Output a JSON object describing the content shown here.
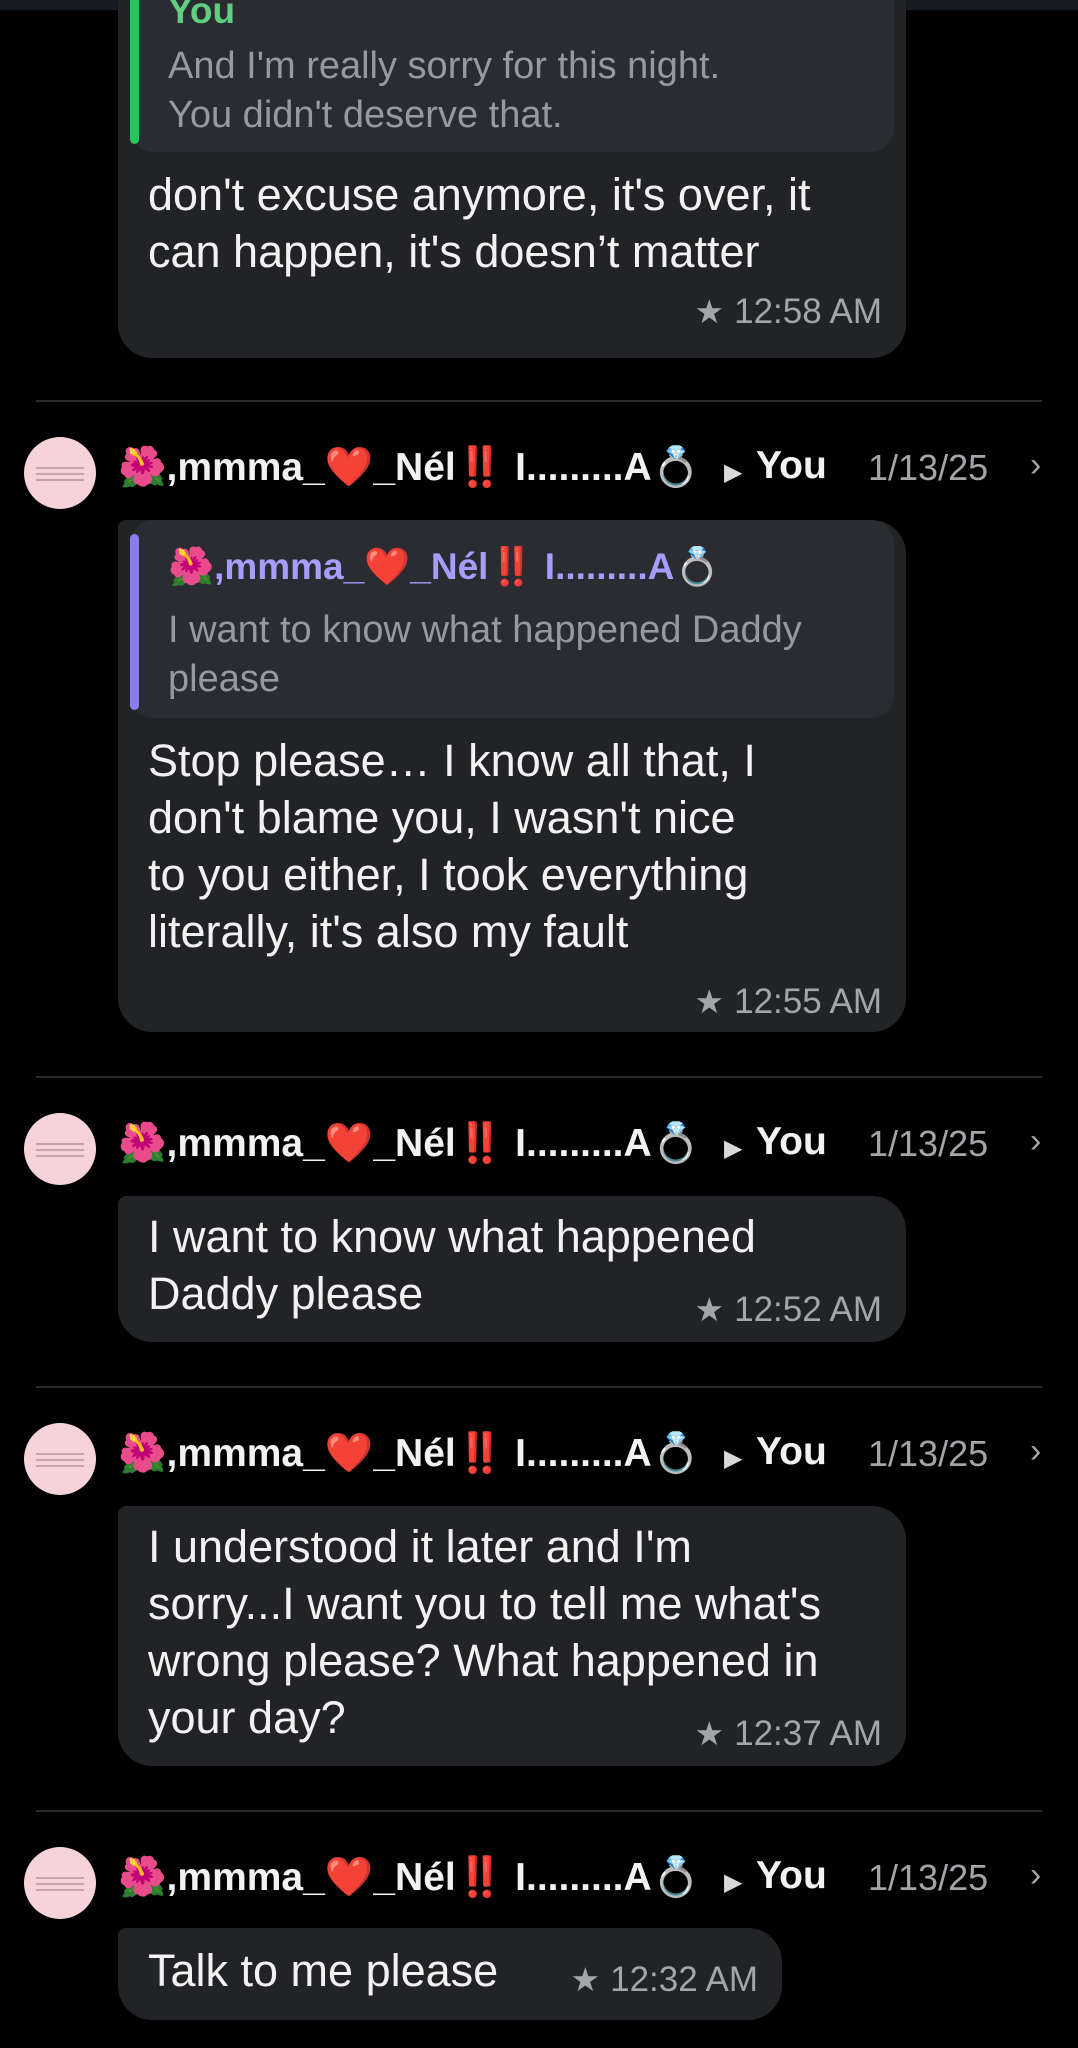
{
  "sender_name": "🌺,mmma_❤️_Nél",
  "sender_marks": "‼️",
  "sender_suffix": " I.........A💍",
  "recipient": "You",
  "star_icon": "star-icon",
  "colors": {
    "background": "#000000",
    "bubble": "#212327",
    "quote_bar_you": "#22c55e",
    "quote_bar_contact": "#8b7cf6"
  },
  "messages": [
    {
      "quote": {
        "author": "You",
        "text_lines": [
          "And I'm really sorry for this night.",
          "You didn't deserve that."
        ]
      },
      "text_lines": [
        "don't excuse anymore, it's over, it",
        "can happen, it's doesn’t matter"
      ],
      "time": "12:58 AM"
    },
    {
      "date": "1/13/25",
      "quote": {
        "author": "🌺,mmma_❤️_Nél‼️ I.........A💍",
        "text_lines": [
          "I want to know what happened Daddy",
          "please"
        ]
      },
      "text_lines": [
        "Stop please… I know all that, I",
        "don't blame you, I wasn't nice",
        "to you either, I took everything",
        "literally, it's also my fault"
      ],
      "time": "12:55 AM"
    },
    {
      "date": "1/13/25",
      "text_lines": [
        "I want to know what happened",
        "Daddy please"
      ],
      "time": "12:52 AM"
    },
    {
      "date": "1/13/25",
      "text_lines": [
        "I understood it later and I'm",
        "sorry...I want you to tell me what's",
        "wrong please? What happened in",
        "your day?"
      ],
      "time": "12:37 AM"
    },
    {
      "date": "1/13/25",
      "text_lines": [
        "Talk to me please"
      ],
      "time": "12:32 AM"
    }
  ]
}
